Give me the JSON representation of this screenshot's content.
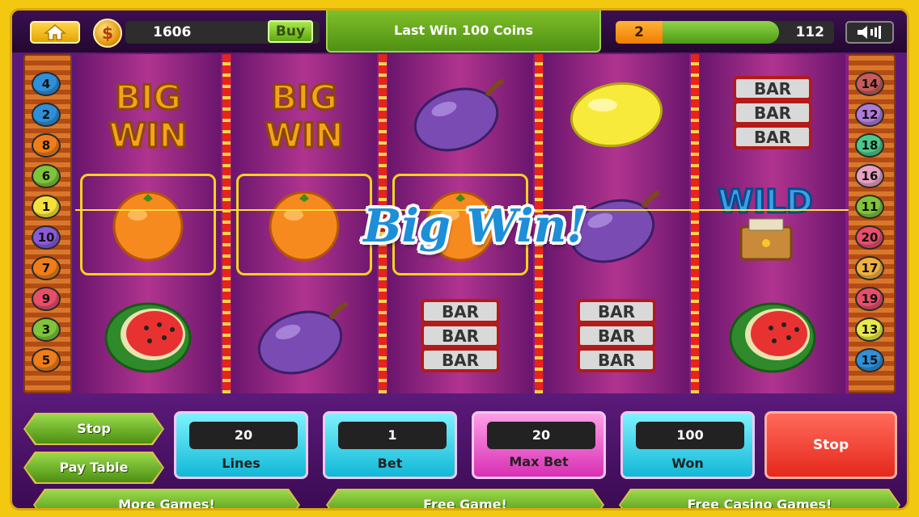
{
  "header": {
    "coins": "1606",
    "buy_label": "Buy",
    "currency_symbol": "$",
    "last_win": "Last Win 100 Coins",
    "level": "2",
    "xp_value": "112",
    "xp_progress": 0.68
  },
  "lines_left": [
    "4",
    "2",
    "8",
    "6",
    "1",
    "10",
    "7",
    "9",
    "3",
    "5"
  ],
  "lines_right": [
    "14",
    "12",
    "18",
    "16",
    "11",
    "20",
    "17",
    "19",
    "13",
    "15"
  ],
  "line_colors": {
    "1": "#f5e13a",
    "2": "#2f8fd8",
    "3": "#7fc43a",
    "4": "#2f8fd8",
    "5": "#f07d1a",
    "6": "#7fc43a",
    "7": "#f07d1a",
    "8": "#f07d1a",
    "9": "#e84e6a",
    "10": "#8a5ad8",
    "11": "#7fc43a",
    "12": "#b07ad8",
    "13": "#e8e84a",
    "14": "#c85a5a",
    "15": "#2f8fd8",
    "16": "#e8a0c0",
    "17": "#f0b040",
    "18": "#4ac88a",
    "19": "#e84e6a",
    "20": "#e84e6a"
  },
  "reels": [
    [
      "big-win",
      "orange",
      "watermelon"
    ],
    [
      "big-win",
      "orange",
      "plum"
    ],
    [
      "plum",
      "orange",
      "bar"
    ],
    [
      "lemon",
      "plum",
      "bar"
    ],
    [
      "bar",
      "wild",
      "watermelon"
    ]
  ],
  "highlighted_row": 1,
  "highlighted_reels": 3,
  "symbol_text": {
    "big_top": "BIG",
    "big_bottom": "WIN",
    "bar": "BAR",
    "wild": "WILD"
  },
  "big_win_banner": "Big Win!",
  "controls": {
    "stop_small": "Stop",
    "pay_table": "Pay Table",
    "lines_value": "20",
    "lines_label": "Lines",
    "bet_value": "1",
    "bet_label": "Bet",
    "max_bet_value": "20",
    "max_bet_label": "Max Bet",
    "won_value": "100",
    "won_label": "Won",
    "stop_big": "Stop",
    "more_games": "More Games!",
    "free_game": "Free Game!",
    "free_casino": "Free Casino Games!"
  }
}
